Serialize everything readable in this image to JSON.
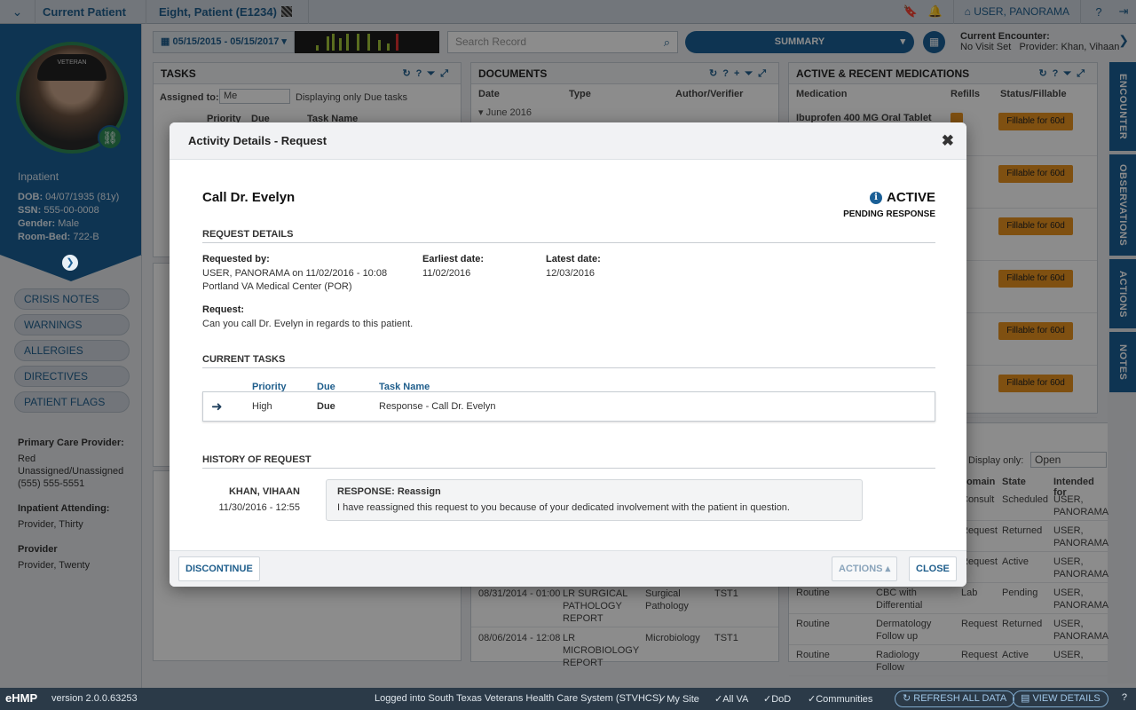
{
  "topbar": {
    "current_patient": "Current Patient",
    "patient_name": "Eight, Patient (E1234)",
    "user": "USER, PANORAMA"
  },
  "patient": {
    "cap_text": "VETERAN",
    "status": "Inpatient",
    "dob_label": "DOB:",
    "dob": "04/07/1935 (81y)",
    "ssn_label": "SSN:",
    "ssn": "555-00-0008",
    "gender_label": "Gender:",
    "gender": "Male",
    "room_label": "Room-Bed:",
    "room": "722-B"
  },
  "sidebar": {
    "buttons": [
      "CRISIS NOTES",
      "WARNINGS",
      "ALLERGIES",
      "DIRECTIVES",
      "PATIENT FLAGS"
    ],
    "pcp_label": "Primary Care Provider:",
    "pcp_lines": [
      "Red",
      "Unassigned/Unassigned",
      "(555) 555-5551"
    ],
    "attending_label": "Inpatient Attending:",
    "attending": "Provider, Thirty",
    "provider_label": "Provider",
    "provider": "Provider, Twenty"
  },
  "toolbar": {
    "date_range": "05/15/2015 - 05/15/2017",
    "search_placeholder": "Search Record",
    "workspace": "SUMMARY",
    "encounter_label": "Current Encounter:",
    "encounter_visit": "No Visit Set",
    "encounter_provider": "Provider: Khan, Vihaan"
  },
  "right_tabs": [
    "ENCOUNTER",
    "OBSERVATIONS",
    "ACTIONS",
    "NOTES"
  ],
  "panels": {
    "tasks": {
      "title": "TASKS",
      "assigned_label": "Assigned to:",
      "assigned_value": "Me",
      "displaying": "Displaying only Due tasks",
      "cols": [
        "Priority",
        "Due",
        "Task Name"
      ]
    },
    "documents": {
      "title": "DOCUMENTS",
      "cols": [
        "Date",
        "Type",
        "Author/Verifier"
      ],
      "group": "June 2016",
      "rows": [
        {
          "date": "08/31/2014 - 01:00",
          "name": "LR SURGICAL PATHOLOGY REPORT",
          "type": "Surgical Pathology",
          "author": "TST1"
        },
        {
          "date": "08/06/2014 - 12:08",
          "name": "LR MICROBIOLOGY REPORT",
          "type": "Microbiology",
          "author": "TST1"
        }
      ]
    },
    "medications": {
      "title": "ACTIVE & RECENT MEDICATIONS",
      "cols": [
        "Medication",
        "Refills",
        "Status/Fillable"
      ],
      "first_med": "Ibuprofen 400 MG Oral Tablet",
      "fillable": [
        "Fillable for 60d",
        "Fillable for 60d",
        "Fillable for 60d",
        "Fillable for 60d",
        "Fillable for 60d",
        "Fillable for 60d"
      ]
    },
    "orders": {
      "display_label": "Display only:",
      "display_value": "Open",
      "cols": [
        "Domain",
        "State",
        "Intended for"
      ],
      "rows": [
        {
          "priority": "",
          "name": "",
          "domain": "Consult",
          "state": "Scheduled",
          "intended": "USER, PANORAMA"
        },
        {
          "priority": "",
          "name": "",
          "domain": "Request",
          "state": "Returned",
          "intended": "USER, PANORAMA"
        },
        {
          "priority": "",
          "name": "",
          "domain": "Request",
          "state": "Active",
          "intended": "USER, PANORAMA"
        },
        {
          "priority": "Routine",
          "name": "CBC with Differential",
          "domain": "Lab",
          "state": "Pending",
          "intended": "USER, PANORAMA"
        },
        {
          "priority": "Routine",
          "name": "Dermatology Follow up",
          "domain": "Request",
          "state": "Returned",
          "intended": "USER, PANORAMA"
        },
        {
          "priority": "Routine",
          "name": "Radiology Follow",
          "domain": "Request",
          "state": "Active",
          "intended": "USER,"
        }
      ]
    }
  },
  "modal": {
    "title": "Activity Details - Request",
    "request_title": "Call Dr. Evelyn",
    "status": "ACTIVE",
    "substatus": "PENDING RESPONSE",
    "sections": {
      "request_details": "REQUEST DETAILS",
      "current_tasks": "CURRENT TASKS",
      "history": "HISTORY OF REQUEST"
    },
    "requested_by_label": "Requested by:",
    "requested_by": "USER, PANORAMA on 11/02/2016 - 10:08",
    "facility": "Portland VA Medical Center (POR)",
    "earliest_label": "Earliest date:",
    "earliest": "11/02/2016",
    "latest_label": "Latest date:",
    "latest": "12/03/2016",
    "request_label": "Request:",
    "request_text": "Can you call Dr. Evelyn in regards to this patient.",
    "task_cols": [
      "Priority",
      "Due",
      "Task Name"
    ],
    "task": {
      "priority": "High",
      "due": "Due",
      "name": "Response - Call Dr. Evelyn"
    },
    "history": {
      "name": "KHAN, VIHAAN",
      "datetime": "11/30/2016 - 12:55",
      "response_title": "RESPONSE: Reassign",
      "response_text": "I have reassigned this request to you because of your dedicated involvement with the patient in question."
    },
    "buttons": {
      "discontinue": "DISCONTINUE",
      "actions": "ACTIONS",
      "close": "CLOSE"
    }
  },
  "footer": {
    "brand": "eHMP",
    "version": "version 2.0.0.63253",
    "logged": "Logged into South Texas Veterans Health Care System (STVHCS)",
    "sites": [
      "My Site",
      "All VA",
      "DoD",
      "Communities"
    ],
    "refresh": "REFRESH ALL DATA",
    "view_details": "VIEW DETAILS"
  }
}
